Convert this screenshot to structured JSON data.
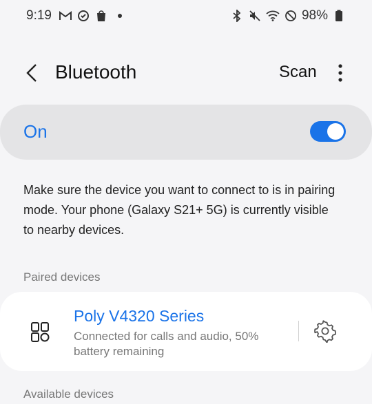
{
  "status_bar": {
    "time": "9:19",
    "left_icons": [
      "gmail-icon",
      "sync-icon",
      "shopify-icon"
    ],
    "right_icons": [
      "bluetooth-icon",
      "mute-icon",
      "wifi-icon",
      "do-not-disturb-icon"
    ],
    "battery": "98%"
  },
  "app_bar": {
    "title": "Bluetooth",
    "scan_label": "Scan"
  },
  "master_switch": {
    "label": "On",
    "enabled": true
  },
  "info": {
    "text": "Make sure the device you want to connect to is in pairing mode. Your phone (Galaxy S21+ 5G) is currently visible to nearby devices."
  },
  "sections": {
    "paired": "Paired devices",
    "available": "Available devices"
  },
  "paired_devices": [
    {
      "name": "Poly V4320 Series",
      "status": "Connected for calls and audio, 50% battery remaining",
      "icon": "device-icon"
    }
  ],
  "colors": {
    "accent": "#1a73e8",
    "background": "#f5f5f7",
    "card": "#e4e4e6"
  }
}
